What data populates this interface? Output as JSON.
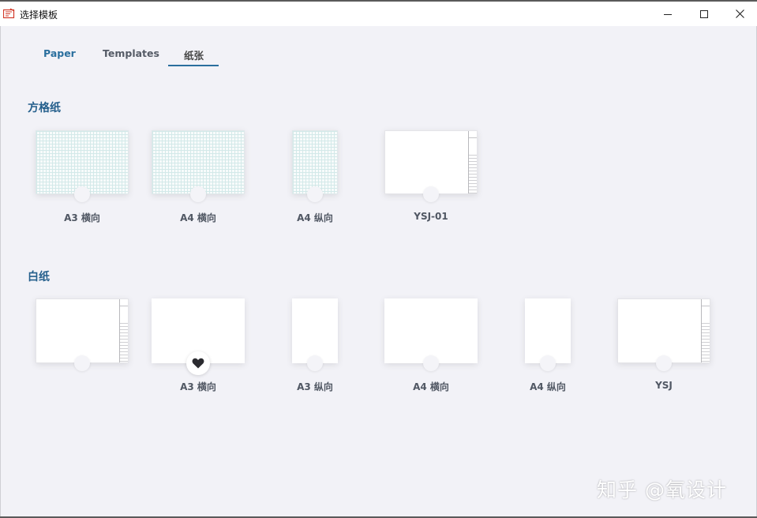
{
  "window": {
    "title": "选择模板"
  },
  "tabs": [
    {
      "label": "Paper"
    },
    {
      "label": "Templates"
    },
    {
      "label": "纸张"
    }
  ],
  "sections": [
    {
      "title": "方格纸",
      "cards": [
        {
          "label": "A3 横向",
          "style": "grid"
        },
        {
          "label": "A4 横向",
          "style": "grid"
        },
        {
          "label": "A4 纵向",
          "style": "grid"
        },
        {
          "label": "YSJ-01",
          "style": "frame"
        }
      ]
    },
    {
      "title": "白纸",
      "cards": [
        {
          "label": "",
          "style": "frame"
        },
        {
          "label": "A3 横向",
          "style": "blank",
          "favorite": true
        },
        {
          "label": "A3 纵向",
          "style": "blank"
        },
        {
          "label": "A4 横向",
          "style": "blank"
        },
        {
          "label": "A4 纵向",
          "style": "blank"
        },
        {
          "label": "YSJ",
          "style": "frame"
        }
      ]
    }
  ],
  "watermark": "知乎 @氧设计",
  "colors": {
    "accent": "#2a6f9e",
    "section_title": "#245f8c",
    "background": "#f2f2f7"
  },
  "icons": [
    "app-icon",
    "minimize-icon",
    "maximize-icon",
    "close-icon",
    "heart-icon"
  ]
}
